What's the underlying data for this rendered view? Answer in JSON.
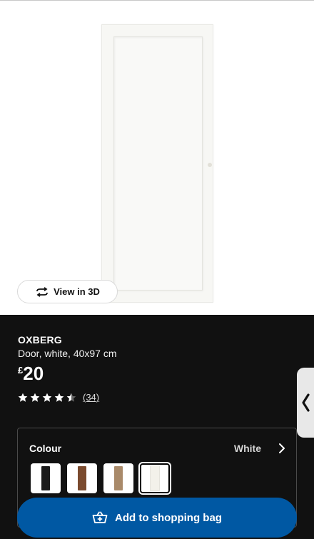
{
  "product_image": {
    "view_3d_label": "View in 3D",
    "icon": "rotate-3d-icon"
  },
  "product": {
    "brand": "OXBERG",
    "description": "Door, white, 40x97 cm",
    "currency_symbol": "£",
    "price": "20",
    "rating": 4.5,
    "rating_max": 5,
    "review_count": "(34)"
  },
  "colour": {
    "label": "Colour",
    "selected_value": "White",
    "swatches": [
      {
        "name": "black",
        "color": "#1a1a1a"
      },
      {
        "name": "brown walnut",
        "color": "#7a4a2e"
      },
      {
        "name": "oak",
        "color": "#a98a6a"
      },
      {
        "name": "white",
        "color": "#f3f1ea",
        "selected": true
      }
    ]
  },
  "cta": {
    "label": "Add to shopping bag",
    "icon": "shopping-bag-icon"
  },
  "side_tab": {
    "icon": "chevron-left-icon"
  },
  "colors": {
    "panel_bg": "#111111",
    "cta_bg": "#0058a3"
  }
}
